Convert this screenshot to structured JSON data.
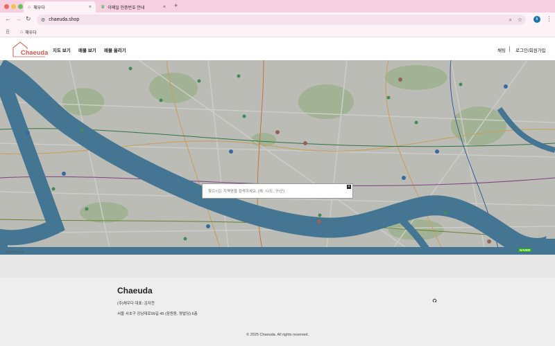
{
  "browser": {
    "tabs": [
      {
        "title": "채우다",
        "active": true
      },
      {
        "title": "이메일 인증번호 안내",
        "active": false
      }
    ],
    "url": "chaeuda.shop",
    "bookmark": "채우다",
    "profile_initial": "k",
    "new_tab_symbol": "+",
    "close_symbol": "×"
  },
  "header": {
    "logo": "Chaeuda",
    "nav": [
      "지도 보기",
      "매물 보기",
      "매물 올리기"
    ],
    "chat": "채팅",
    "login": "로그인/회원가입"
  },
  "map": {
    "search_placeholder": "찾으시는 지역명을 검색하세요. (예: 시/도, 구/군)",
    "close_label": "✕",
    "attribution": "© NAVER Corp.",
    "provider_logo": "NAVER",
    "colors": {
      "river": "#3c7fa6",
      "land": "#dcdcd6",
      "park": "#b9d1a7"
    }
  },
  "footer": {
    "brand": "Chaeuda",
    "company": "(주)채우다 대표: 김자천",
    "address": "서울 서초구 강남대로99길 45 (잠원동, 명발딩) 6층",
    "copyright": "© 2025 Chaeuda. All rights reserved."
  },
  "colors": {
    "brand": "#d3544a",
    "tab_bar": "#f6cfe0",
    "toolbar": "#fdf3f7"
  }
}
